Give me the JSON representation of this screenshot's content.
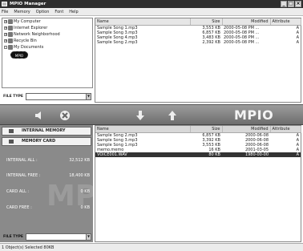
{
  "window": {
    "title": "MPIO Manager"
  },
  "menu": [
    "File",
    "Memory",
    "Option",
    "Font",
    "Help"
  ],
  "tree": {
    "items": [
      {
        "label": "My Computer",
        "expander": "+"
      },
      {
        "label": "Internet Explorer",
        "expander": "+"
      },
      {
        "label": "Network Neighborhood",
        "expander": "+"
      },
      {
        "label": "Recycle Bin",
        "expander": "+"
      },
      {
        "label": "My Documents",
        "expander": "-"
      }
    ],
    "selected_child": "MPIO"
  },
  "pc_file_type": {
    "label": "FILE TYPE",
    "value": ""
  },
  "pc_files": {
    "columns": [
      "Name",
      "Size",
      "Modified",
      "Attribute"
    ],
    "rows": [
      {
        "name": "Sample Song 1.mp3",
        "size": "3,553 KB",
        "modified": "2000-05-08 PM ...",
        "attr": "A"
      },
      {
        "name": "Sample Song 3.mp3",
        "size": "6,857 KB",
        "modified": "2000-05-08 PM ...",
        "attr": "A"
      },
      {
        "name": "Sample Song 4.mp3",
        "size": "3,483 KB",
        "modified": "2000-05-08 PM ...",
        "attr": "A"
      },
      {
        "name": "Sample Song 2.mp3",
        "size": "2,392 KB",
        "modified": "2000-05-08 PM ...",
        "attr": "A"
      }
    ]
  },
  "toolbar": {
    "logo": "MPIO"
  },
  "memory": {
    "internal_label": "INTERNAL MEMORY",
    "card_label": "MEMORY CARD",
    "stats": [
      {
        "label": "INTERNAL ALL :",
        "value": "32,512 KB"
      },
      {
        "label": "INTERNAL FREE :",
        "value": "18,400 KB"
      },
      {
        "label": "CARD ALL :",
        "value": "0 KB"
      },
      {
        "label": "CARD FREE :",
        "value": "0 KB"
      }
    ],
    "watermark": "MPIO"
  },
  "player_file_type": {
    "label": "FILE TYPE",
    "value": ""
  },
  "player_files": {
    "columns": [
      "Name",
      "Size",
      "Modified",
      "Attribute"
    ],
    "rows": [
      {
        "name": "Sample Song 2.mp3",
        "size": "6,857 KB",
        "modified": "2000-06-08",
        "attr": "A",
        "selected": false
      },
      {
        "name": "Sample Song 3.mp3",
        "size": "3,392 KB",
        "modified": "2000-06-08",
        "attr": "A",
        "selected": false
      },
      {
        "name": "Sample Song 1.mp3",
        "size": "3,553 KB",
        "modified": "2000-06-08",
        "attr": "A",
        "selected": false
      },
      {
        "name": "memo.memo",
        "size": "16 KB",
        "modified": "2001-03-05",
        "attr": "A",
        "selected": false
      },
      {
        "name": "VOICE001.WAV",
        "size": "80 KB",
        "modified": "1980-00-00",
        "attr": "A",
        "selected": true
      }
    ]
  },
  "status": {
    "text": "1 Object(s) Selected   80KB"
  }
}
